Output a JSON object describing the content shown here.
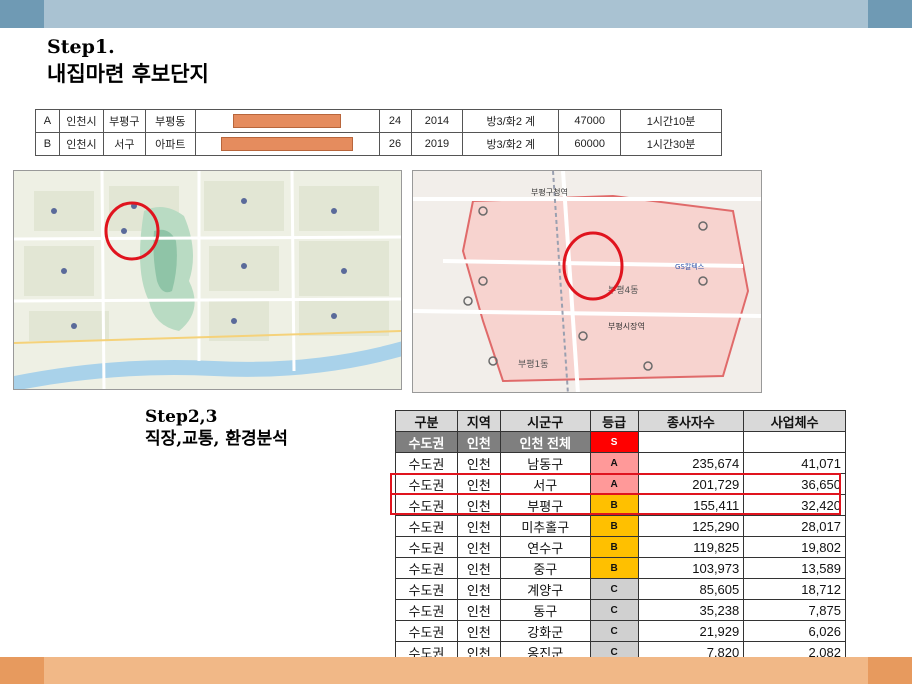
{
  "step1": {
    "title": "Step1.",
    "subtitle": "내집마련 후보단지"
  },
  "candidates": [
    {
      "id": "A",
      "city": "인천시",
      "district": "부평구",
      "dong": "부평동",
      "bar_fraction": 0.77,
      "col1": "24",
      "year": "2014",
      "rooms": "방3/화2 계",
      "price": "47000",
      "commute": "1시간10분"
    },
    {
      "id": "B",
      "city": "인천시",
      "district": "서구",
      "dong": "아파트",
      "bar_fraction": 0.94,
      "col1": "26",
      "year": "2019",
      "rooms": "방3/화2 계",
      "price": "60000",
      "commute": "1시간30분"
    }
  ],
  "step23": {
    "title": "Step2,3",
    "subtitle": "직장,교통, 환경분석"
  },
  "map_right": {
    "station1": "부평구청역",
    "station2": "부평시장역",
    "dong1": "부평4동",
    "dong2": "부평1동",
    "place1": "GS칼텍스"
  },
  "stats": {
    "headers": [
      "구분",
      "지역",
      "시군구",
      "등급",
      "종사자수",
      "사업체수"
    ],
    "total": {
      "region": "수도권",
      "area": "인천",
      "district": "인천 전체",
      "grade": "S",
      "grade_color": "#ff0000",
      "workers": "",
      "companies": ""
    },
    "rows": [
      {
        "region": "수도권",
        "area": "인천",
        "district": "남동구",
        "grade": "A",
        "grade_color": "#ff9999",
        "workers": "235,674",
        "companies": "41,071"
      },
      {
        "region": "수도권",
        "area": "인천",
        "district": "서구",
        "grade": "A",
        "grade_color": "#ff9999",
        "workers": "201,729",
        "companies": "36,650"
      },
      {
        "region": "수도권",
        "area": "인천",
        "district": "부평구",
        "grade": "B",
        "grade_color": "#ffc000",
        "workers": "155,411",
        "companies": "32,420"
      },
      {
        "region": "수도권",
        "area": "인천",
        "district": "미추홀구",
        "grade": "B",
        "grade_color": "#ffc000",
        "workers": "125,290",
        "companies": "28,017"
      },
      {
        "region": "수도권",
        "area": "인천",
        "district": "연수구",
        "grade": "B",
        "grade_color": "#ffc000",
        "workers": "119,825",
        "companies": "19,802"
      },
      {
        "region": "수도권",
        "area": "인천",
        "district": "중구",
        "grade": "B",
        "grade_color": "#ffc000",
        "workers": "103,973",
        "companies": "13,589"
      },
      {
        "region": "수도권",
        "area": "인천",
        "district": "계양구",
        "grade": "C",
        "grade_color": "#d0d0d0",
        "workers": "85,605",
        "companies": "18,712"
      },
      {
        "region": "수도권",
        "area": "인천",
        "district": "동구",
        "grade": "C",
        "grade_color": "#d0d0d0",
        "workers": "35,238",
        "companies": "7,875"
      },
      {
        "region": "수도권",
        "area": "인천",
        "district": "강화군",
        "grade": "C",
        "grade_color": "#d0d0d0",
        "workers": "21,929",
        "companies": "6,026"
      },
      {
        "region": "수도권",
        "area": "인천",
        "district": "옹진군",
        "grade": "C",
        "grade_color": "#d0d0d0",
        "workers": "7,820",
        "companies": "2,082"
      }
    ],
    "highlight_color": "#e0141e"
  },
  "theme": {
    "top_bar": "#a9c2d2",
    "bottom_bar": "#f1b887",
    "bar_fill": "#e58c5e"
  }
}
